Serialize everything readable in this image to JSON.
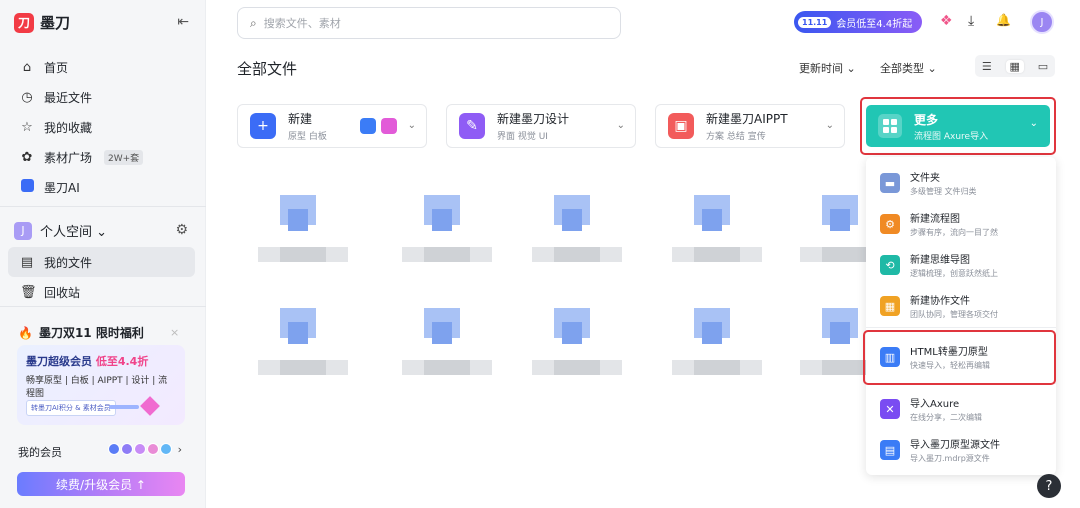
{
  "app": {
    "logo_mark": "刀",
    "logo_text": "墨刀",
    "collapse_icon": "⇤"
  },
  "nav": {
    "items": [
      {
        "icon": "⌂",
        "label": "首页"
      },
      {
        "icon": "◷",
        "label": "最近文件"
      },
      {
        "icon": "☆",
        "label": "我的收藏"
      },
      {
        "icon": "✿",
        "label": "素材广场",
        "tag": "2W+套"
      },
      {
        "label": "墨刀AI"
      }
    ]
  },
  "space": {
    "badge": "J",
    "label": "个人空间 ⌄",
    "gear": "⚙"
  },
  "nav2": {
    "items": [
      {
        "icon": "▤",
        "label": "我的文件"
      },
      {
        "icon": "🗑",
        "label": "回收站"
      }
    ]
  },
  "promo": {
    "title": "墨刀双11 限时福利",
    "fire": "🔥",
    "close": "×",
    "line1_a": "墨刀超级会员",
    "line1_b": "低至4.4折",
    "line2": "畅享原型 | 白板 | AIPPT | 设计 | 流程图",
    "chip": "转墨刀AI积分 & 素材会员"
  },
  "member": {
    "label": "我的会员",
    "arrow": "›"
  },
  "renew": {
    "label": "续费/升级会员 ↑"
  },
  "search": {
    "icon": "⌕",
    "placeholder": "搜索文件、素材"
  },
  "topbar": {
    "vip_badge": "11.11",
    "vip_text": "会员低至4.4折起",
    "download_icon": "⤓",
    "bell_icon": "🔔",
    "avatar": "J"
  },
  "main": {
    "title": "全部文件",
    "sort": "更新时间 ⌄",
    "type": "全部类型 ⌄",
    "view_list": "☰",
    "view_grid": "▦",
    "view_board": "▭"
  },
  "create": [
    {
      "icon": "+",
      "title": "新建",
      "sub": "原型 白板",
      "color": "#3b6cf6"
    },
    {
      "icon": "✎",
      "title": "新建墨刀设计",
      "sub": "界面 视觉 UI",
      "color": "#8f5cf5"
    },
    {
      "icon": "▣",
      "title": "新建墨刀AIPPT",
      "sub": "方案 总结 宣传",
      "color": "#f25b5b"
    }
  ],
  "more": {
    "title": "更多",
    "sub": "流程图 Axure导入",
    "chev": "⌄"
  },
  "menu": {
    "items": [
      {
        "icon": "▬",
        "title": "文件夹",
        "sub": "多级管理 文件归类",
        "color": "#7a98d8"
      },
      {
        "icon": "⚙",
        "title": "新建流程图",
        "sub": "步骤有序，流向一目了然",
        "color": "#f08a24"
      },
      {
        "icon": "⟲",
        "title": "新建思维导图",
        "sub": "逻辑梳理，创意跃然纸上",
        "color": "#1fb9a6"
      },
      {
        "icon": "▦",
        "title": "新建协作文件",
        "sub": "团队协同，管理各项交付",
        "color": "#f0a224"
      },
      {
        "icon": "▥",
        "title": "HTML转墨刀原型",
        "sub": "快速导入，轻松再编辑",
        "color": "#3b7cf6"
      },
      {
        "icon": "✕",
        "title": "导入Axure",
        "sub": "在线分享，二次编辑",
        "color": "#7a4cf2"
      },
      {
        "icon": "▤",
        "title": "导入墨刀原型源文件",
        "sub": "导入墨刀.mdrp源文件",
        "color": "#3b7cf6"
      }
    ]
  },
  "help": "?"
}
